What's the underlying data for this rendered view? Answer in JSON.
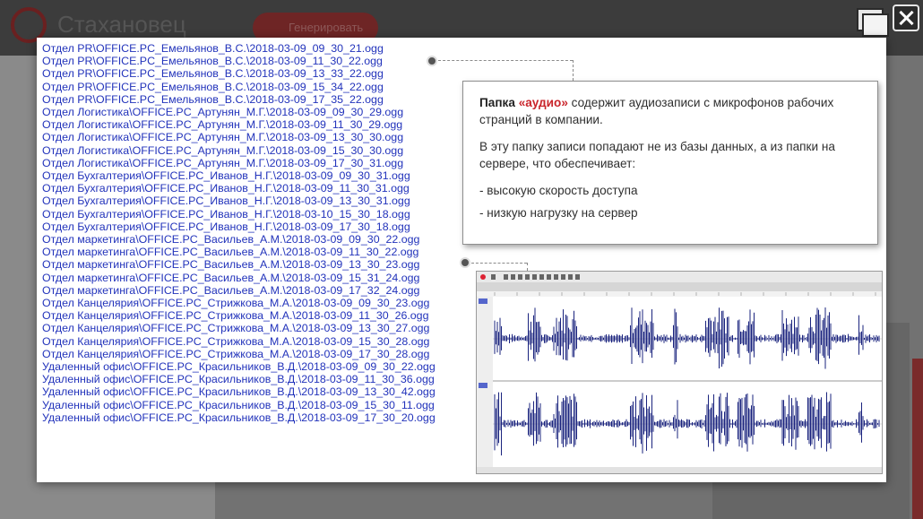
{
  "app": {
    "title": "Стахановец",
    "generate_button": "Генерировать"
  },
  "file_list": [
    "Отдел PR\\OFFICE.PC_Емельянов_В.С.\\2018-03-09_09_30_21.ogg",
    "Отдел PR\\OFFICE.PC_Емельянов_В.С.\\2018-03-09_11_30_22.ogg",
    "Отдел PR\\OFFICE.PC_Емельянов_В.С.\\2018-03-09_13_33_22.ogg",
    "Отдел PR\\OFFICE.PC_Емельянов_В.С.\\2018-03-09_15_34_22.ogg",
    "Отдел PR\\OFFICE.PC_Емельянов_В.С.\\2018-03-09_17_35_22.ogg",
    "Отдел Логистика\\OFFICE.PC_Артунян_М.Г.\\2018-03-09_09_30_29.ogg",
    "Отдел Логистика\\OFFICE.PC_Артунян_М.Г.\\2018-03-09_11_30_29.ogg",
    "Отдел Логистика\\OFFICE.PC_Артунян_М.Г.\\2018-03-09_13_30_30.ogg",
    "Отдел Логистика\\OFFICE.PC_Артунян_М.Г.\\2018-03-09_15_30_30.ogg",
    "Отдел Логистика\\OFFICE.PC_Артунян_М.Г.\\2018-03-09_17_30_31.ogg",
    "Отдел Бухгалтерия\\OFFICE.PC_Иванов_Н.Г.\\2018-03-09_09_30_31.ogg",
    "Отдел Бухгалтерия\\OFFICE.PC_Иванов_Н.Г.\\2018-03-09_11_30_31.ogg",
    "Отдел Бухгалтерия\\OFFICE.PC_Иванов_Н.Г.\\2018-03-09_13_30_31.ogg",
    "Отдел Бухгалтерия\\OFFICE.PC_Иванов_Н.Г.\\2018-03-10_15_30_18.ogg",
    "Отдел Бухгалтерия\\OFFICE.PC_Иванов_Н.Г.\\2018-03-09_17_30_18.ogg",
    "Отдел маркетинга\\OFFICE.PC_Васильев_А.М.\\2018-03-09_09_30_22.ogg",
    "Отдел маркетинга\\OFFICE.PC_Васильев_А.М.\\2018-03-09_11_30_22.ogg",
    "Отдел маркетинга\\OFFICE.PC_Васильев_А.М.\\2018-03-09_13_30_23.ogg",
    "Отдел маркетинга\\OFFICE.PC_Васильев_А.М.\\2018-03-09_15_31_24.ogg",
    "Отдел маркетинга\\OFFICE.PC_Васильев_А.М.\\2018-03-09_17_32_24.ogg",
    "Отдел Канцелярия\\OFFICE.PC_Стрижкова_М.А.\\2018-03-09_09_30_23.ogg",
    "Отдел Канцелярия\\OFFICE.PC_Стрижкова_М.А.\\2018-03-09_11_30_26.ogg",
    "Отдел Канцелярия\\OFFICE.PC_Стрижкова_М.А.\\2018-03-09_13_30_27.ogg",
    "Отдел Канцелярия\\OFFICE.PC_Стрижкова_М.А.\\2018-03-09_15_30_28.ogg",
    "Отдел Канцелярия\\OFFICE.PC_Стрижкова_М.А.\\2018-03-09_17_30_28.ogg",
    "Удаленный офис\\OFFICE.PC_Красильников_В.Д.\\2018-03-09_09_30_22.ogg",
    "Удаленный офис\\OFFICE.PC_Красильников_В.Д.\\2018-03-09_11_30_36.ogg",
    "Удаленный офис\\OFFICE.PC_Красильников_В.Д.\\2018-03-09_13_30_42.ogg",
    "Удаленный офис\\OFFICE.PC_Красильников_В.Д.\\2018-03-09_15_30_11.ogg",
    "Удаленный офис\\OFFICE.PC_Красильников_В.Д.\\2018-03-09_17_30_20.ogg"
  ],
  "callout": {
    "lead_bold": "Папка ",
    "lead_accent": "«аудио»",
    "lead_rest": " содержит аудиозаписи с микрофонов рабочих странций в компании.",
    "para2": "В эту папку записи попадают не из базы данных, а из папки на сервере, что обеспечивает:",
    "bullets": [
      "- высокую скорость доступа",
      "- низкую нагрузку на сервер"
    ]
  },
  "icons": {
    "restore": "restore-window-icon",
    "close": "close-window-icon"
  },
  "colors": {
    "link": "#2233bb",
    "accent": "#c9252b",
    "waveform": "#1a237e"
  }
}
